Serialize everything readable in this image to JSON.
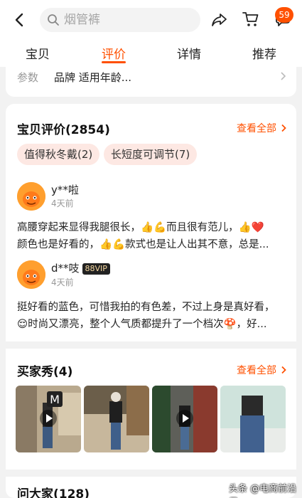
{
  "header": {
    "search_placeholder": "烟管裤",
    "badge_count": "59"
  },
  "tabs": [
    "宝贝",
    "评价",
    "详情",
    "推荐"
  ],
  "params": {
    "label": "参数",
    "value": "品牌 适用年龄..."
  },
  "reviews": {
    "title": "宝贝评价(2854)",
    "see_all": "查看全部",
    "tags": [
      "值得秋冬戴(2)",
      "长短度可调节(7)"
    ],
    "items": [
      {
        "user": "y**啦",
        "time": "4天前",
        "vip": "",
        "line1": "高腰穿起来显得我腿很长，👍💪而且很有范儿，👍❤️",
        "line2": "颜色也是好看的，👍💪款式也是让人出其不意，总是..."
      },
      {
        "user": "d**吱",
        "time": "4天前",
        "vip": "88VIP",
        "line1": "挺好看的蓝色，可惜我拍的有色差，不过上身是真好看，",
        "line2": "😌时尚又漂亮，整个人气质都提升了一个档次🍄，好..."
      }
    ]
  },
  "buyer_show": {
    "title": "买家秀(4)",
    "see_all": "查看全部",
    "photos": [
      {
        "icon": "play-icon"
      },
      {
        "icon": "none"
      },
      {
        "icon": "play-icon"
      },
      {
        "icon": "none"
      }
    ]
  },
  "qa": {
    "title": "问大家(128)"
  },
  "watermark": "头条 @电商前沿君",
  "colors": {
    "accent": "#ff5000",
    "tag_bg": "#fde8e3"
  }
}
